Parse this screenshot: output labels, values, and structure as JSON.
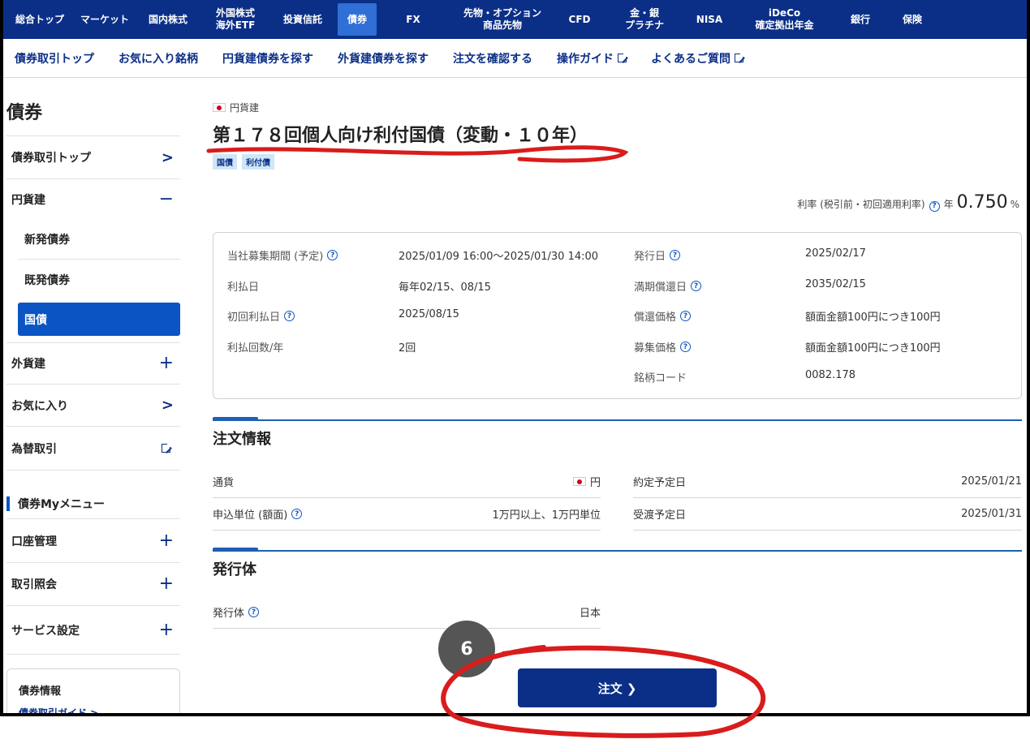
{
  "topnav": [
    "総合トップ",
    "マーケット",
    "国内株式",
    "外国株式\n海外ETF",
    "投資信託",
    "債券",
    "FX",
    "先物・オプション\n商品先物",
    "CFD",
    "金・銀\nプラチナ",
    "NISA",
    "iDeCo\n確定拠出年金",
    "銀行",
    "保険"
  ],
  "subnav": {
    "items": [
      "債券取引トップ",
      "お気に入り銘柄",
      "円貨建債券を探す",
      "外貨建債券を探す",
      "注文を確認する",
      "操作ガイド",
      "よくあるご質問"
    ]
  },
  "sidebar": {
    "title": "債券",
    "top_link": "債券取引トップ",
    "yen": "円貨建",
    "new_issue": "新発債券",
    "existing": "既発債券",
    "jgb": "国債",
    "foreign": "外貨建",
    "favorites": "お気に入り",
    "fx_trade": "為替取引",
    "my_menu": "債券Myメニュー",
    "account": "口座管理",
    "inquiry": "取引照会",
    "service": "サービス設定",
    "info_box_title": "債券情報",
    "info_box_link": "債券取引ガイド >"
  },
  "bond": {
    "currency": "円貨建",
    "title": "第１７８回個人向け利付国債（変動・１０年）",
    "tags": [
      "国債",
      "利付債"
    ],
    "rate_label": "利率 (税引前・初回適用利率)",
    "rate_prefix": "年",
    "rate_value": "0.750",
    "rate_unit": "%"
  },
  "details": {
    "offer_period_label": "当社募集期間 (予定)",
    "offer_period_value": "2025/01/09 16:00〜2025/01/30 14:00",
    "interest_date_label": "利払日",
    "interest_date_value": "毎年02/15、08/15",
    "first_interest_label": "初回利払日",
    "first_interest_value": "2025/08/15",
    "interest_count_label": "利払回数/年",
    "interest_count_value": "2回",
    "issue_date_label": "発行日",
    "issue_date_value": "2025/02/17",
    "maturity_label": "満期償還日",
    "maturity_value": "2035/02/15",
    "redemption_label": "償還価格",
    "redemption_value": "額面金額100円につき100円",
    "offer_price_label": "募集価格",
    "offer_price_value": "額面金額100円につき100円",
    "code_label": "銘柄コード",
    "code_value": "0082.178"
  },
  "order_info": {
    "title": "注文情報",
    "currency_label": "通貨",
    "currency_value": "円",
    "unit_label": "申込単位 (額面)",
    "unit_value": "1万円以上、1万円単位",
    "contract_label": "約定予定日",
    "contract_value": "2025/01/21",
    "delivery_label": "受渡予定日",
    "delivery_value": "2025/01/31"
  },
  "issuer": {
    "title": "発行体",
    "label": "発行体",
    "value": "日本"
  },
  "order_button": "注文 ❯",
  "step_badge": "6",
  "colors": {
    "navy": "#0b2f87",
    "active_blue": "#0b54c4",
    "annotation_red": "#d91c1c"
  }
}
